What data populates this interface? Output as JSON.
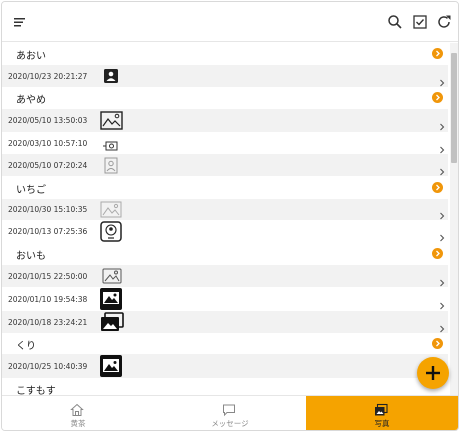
{
  "header": {
    "menu_icon": "menu-icon",
    "actions": [
      "search-icon",
      "checkbox-icon",
      "refresh-icon"
    ]
  },
  "list": {
    "groups": [
      {
        "title": "あおい",
        "items": [
          {
            "date": "2020/10/23 20:21:27",
            "icon": "portrait-photo-icon"
          }
        ]
      },
      {
        "title": "あやめ",
        "items": [
          {
            "date": "2020/05/10 13:50:03",
            "icon": "landscape-photo-icon"
          },
          {
            "date": "2020/03/10 10:57:10",
            "icon": "camera-icon"
          },
          {
            "date": "2020/05/10 07:20:24",
            "icon": "portrait-photo-icon"
          }
        ]
      },
      {
        "title": "いちご",
        "items": [
          {
            "date": "2020/10/30 15:10:35",
            "icon": "landscape-photo-icon"
          },
          {
            "date": "2020/10/13 07:25:36",
            "icon": "picture-frame-icon"
          }
        ]
      },
      {
        "title": "おいも",
        "items": [
          {
            "date": "2020/10/15 22:50:00",
            "icon": "image-icon"
          },
          {
            "date": "2020/01/10 19:54:38",
            "icon": "image-icon"
          },
          {
            "date": "2020/10/18 23:24:21",
            "icon": "photo-stack-icon"
          }
        ]
      },
      {
        "title": "くり",
        "items": [
          {
            "date": "2020/10/25 10:40:39",
            "icon": "image-icon"
          }
        ]
      },
      {
        "title": "こすもす",
        "items": []
      }
    ]
  },
  "nav": {
    "tabs": [
      {
        "label": "黄茶",
        "icon": "home-icon",
        "active": false
      },
      {
        "label": "メッセージ",
        "icon": "chat-icon",
        "active": false
      },
      {
        "label": "写真",
        "icon": "photo-icon",
        "active": true
      }
    ]
  },
  "colors": {
    "accent": "#f5a300",
    "badge": "#f0960a",
    "row_gray": "#f2f2f2"
  },
  "fab": {
    "icon": "plus-icon"
  }
}
